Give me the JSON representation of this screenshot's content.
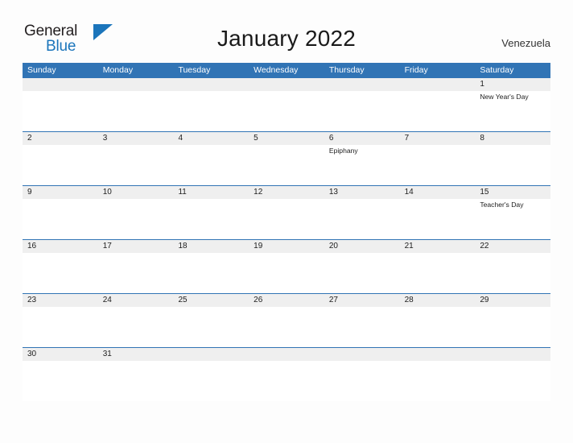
{
  "brand": {
    "word_one": "General",
    "word_two": "Blue",
    "flag_icon": "blue-triangle-flag-icon",
    "primary_color": "#1b75bb"
  },
  "header": {
    "title": "January 2022",
    "country": "Venezuela"
  },
  "theme": {
    "header_blue": "#3174b5",
    "date_band_gray": "#efefef",
    "page_background": "#fdfdfd",
    "text_color": "#1d1d1d"
  },
  "calendar": {
    "month": "January",
    "year": "2022",
    "weekdays": [
      "Sunday",
      "Monday",
      "Tuesday",
      "Wednesday",
      "Thursday",
      "Friday",
      "Saturday"
    ],
    "weeks": [
      [
        {
          "day": "",
          "event": ""
        },
        {
          "day": "",
          "event": ""
        },
        {
          "day": "",
          "event": ""
        },
        {
          "day": "",
          "event": ""
        },
        {
          "day": "",
          "event": ""
        },
        {
          "day": "",
          "event": ""
        },
        {
          "day": "1",
          "event": "New Year's Day"
        }
      ],
      [
        {
          "day": "2",
          "event": ""
        },
        {
          "day": "3",
          "event": ""
        },
        {
          "day": "4",
          "event": ""
        },
        {
          "day": "5",
          "event": ""
        },
        {
          "day": "6",
          "event": "Epiphany"
        },
        {
          "day": "7",
          "event": ""
        },
        {
          "day": "8",
          "event": ""
        }
      ],
      [
        {
          "day": "9",
          "event": ""
        },
        {
          "day": "10",
          "event": ""
        },
        {
          "day": "11",
          "event": ""
        },
        {
          "day": "12",
          "event": ""
        },
        {
          "day": "13",
          "event": ""
        },
        {
          "day": "14",
          "event": ""
        },
        {
          "day": "15",
          "event": "Teacher's Day"
        }
      ],
      [
        {
          "day": "16",
          "event": ""
        },
        {
          "day": "17",
          "event": ""
        },
        {
          "day": "18",
          "event": ""
        },
        {
          "day": "19",
          "event": ""
        },
        {
          "day": "20",
          "event": ""
        },
        {
          "day": "21",
          "event": ""
        },
        {
          "day": "22",
          "event": ""
        }
      ],
      [
        {
          "day": "23",
          "event": ""
        },
        {
          "day": "24",
          "event": ""
        },
        {
          "day": "25",
          "event": ""
        },
        {
          "day": "26",
          "event": ""
        },
        {
          "day": "27",
          "event": ""
        },
        {
          "day": "28",
          "event": ""
        },
        {
          "day": "29",
          "event": ""
        }
      ],
      [
        {
          "day": "30",
          "event": ""
        },
        {
          "day": "31",
          "event": ""
        },
        {
          "day": "",
          "event": ""
        },
        {
          "day": "",
          "event": ""
        },
        {
          "day": "",
          "event": ""
        },
        {
          "day": "",
          "event": ""
        },
        {
          "day": "",
          "event": ""
        }
      ]
    ]
  }
}
